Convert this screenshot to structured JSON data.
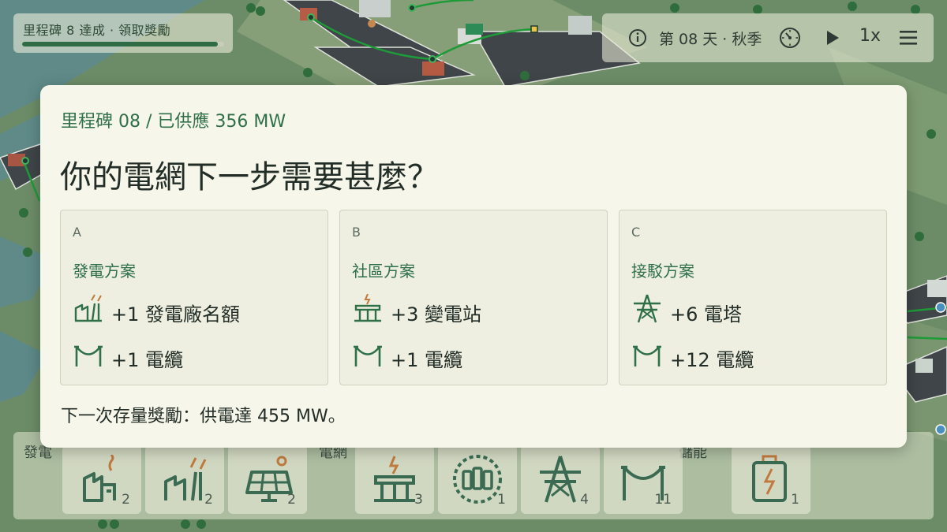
{
  "milestone_pill": {
    "label": "里程碑 8 達成 · 領取獎勵",
    "progress": 0.97
  },
  "status_bar": {
    "day_label": "第 08 天 · 秋季",
    "speed_label": "1x"
  },
  "toolbar": {
    "categories": {
      "generation": "發電",
      "grid": "電網",
      "storage": "儲能"
    },
    "tools": [
      {
        "icon": "coal-plant-icon",
        "count": "2"
      },
      {
        "icon": "wind-plant-icon",
        "count": "2"
      },
      {
        "icon": "solar-panel-icon",
        "count": "2"
      },
      {
        "icon": "substation-icon",
        "count": "3"
      },
      {
        "icon": "battery-bank-icon",
        "count": "1"
      },
      {
        "icon": "pylon-icon",
        "count": "4"
      },
      {
        "icon": "cable-icon",
        "count": "11"
      },
      {
        "icon": "battery-icon",
        "count": "1"
      }
    ]
  },
  "modal": {
    "subtitle": "里程碑 08 / 已供應 356 MW",
    "title": "你的電網下一步需要甚麼？",
    "options": [
      {
        "letter": "A",
        "kind": "發電方案",
        "rewards": [
          {
            "icon": "power-plant-icon",
            "text": "+1 發電廠名額"
          },
          {
            "icon": "cable-icon",
            "text": "+1 電纜"
          }
        ]
      },
      {
        "letter": "B",
        "kind": "社區方案",
        "rewards": [
          {
            "icon": "substation-icon",
            "text": "+3 變電站"
          },
          {
            "icon": "cable-icon",
            "text": "+1 電纜"
          }
        ]
      },
      {
        "letter": "C",
        "kind": "接駁方案",
        "rewards": [
          {
            "icon": "pylon-icon",
            "text": "+6 電塔"
          },
          {
            "icon": "cable-icon",
            "text": "+12 電纜"
          }
        ]
      }
    ],
    "footnote": "下一次存量獎勵：供電達 455 MW。"
  },
  "colors": {
    "accent": "#2f7049",
    "ground": "#6f8f6a",
    "water": "#5d8a8a",
    "power_line": "#1e9a38",
    "modal_bg": "#f7f6ea"
  }
}
